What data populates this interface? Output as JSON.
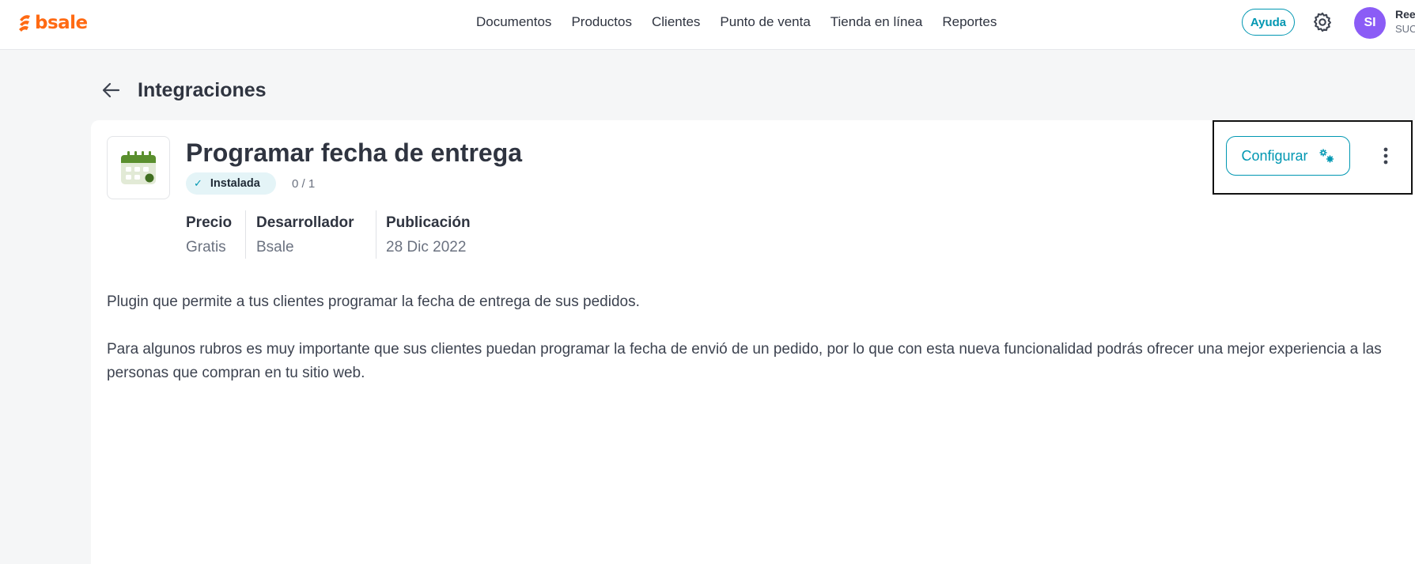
{
  "brand": {
    "name": "bsale",
    "color": "#ff6a13"
  },
  "nav": {
    "items": [
      {
        "label": "Documentos"
      },
      {
        "label": "Productos"
      },
      {
        "label": "Clientes"
      },
      {
        "label": "Punto de venta"
      },
      {
        "label": "Tienda en línea"
      },
      {
        "label": "Reportes"
      }
    ]
  },
  "header": {
    "help_label": "Ayuda",
    "avatar_initials": "SI",
    "user_name": "Ree",
    "user_store": "SUC"
  },
  "page": {
    "title": "Integraciones"
  },
  "app": {
    "title": "Programar fecha de entrega",
    "status": "Instalada",
    "count": "0 / 1",
    "meta": [
      {
        "label": "Precio",
        "value": "Gratis"
      },
      {
        "label": "Desarrollador",
        "value": "Bsale"
      },
      {
        "label": "Publicación",
        "value": "28 Dic 2022"
      }
    ],
    "description": [
      "Plugin que permite a tus clientes programar la fecha de entrega de sus pedidos.",
      "Para algunos rubros es muy importante que sus clientes puedan programar la fecha de envió de un pedido, por lo que con esta nueva funcionalidad podrás ofrecer una mejor experiencia a las personas que compran en tu sitio web."
    ],
    "configure_label": "Configurar"
  },
  "colors": {
    "accent": "#0097b2",
    "avatar": "#8b5cf6",
    "badge_bg": "#e4f4f7",
    "calendar_green": "#5a8f2e"
  },
  "icons": {
    "back": "arrow-left-icon",
    "settings": "gear-icon",
    "app": "calendar-icon",
    "check": "check-icon",
    "configure": "gears-icon",
    "more": "kebab-menu-icon"
  }
}
